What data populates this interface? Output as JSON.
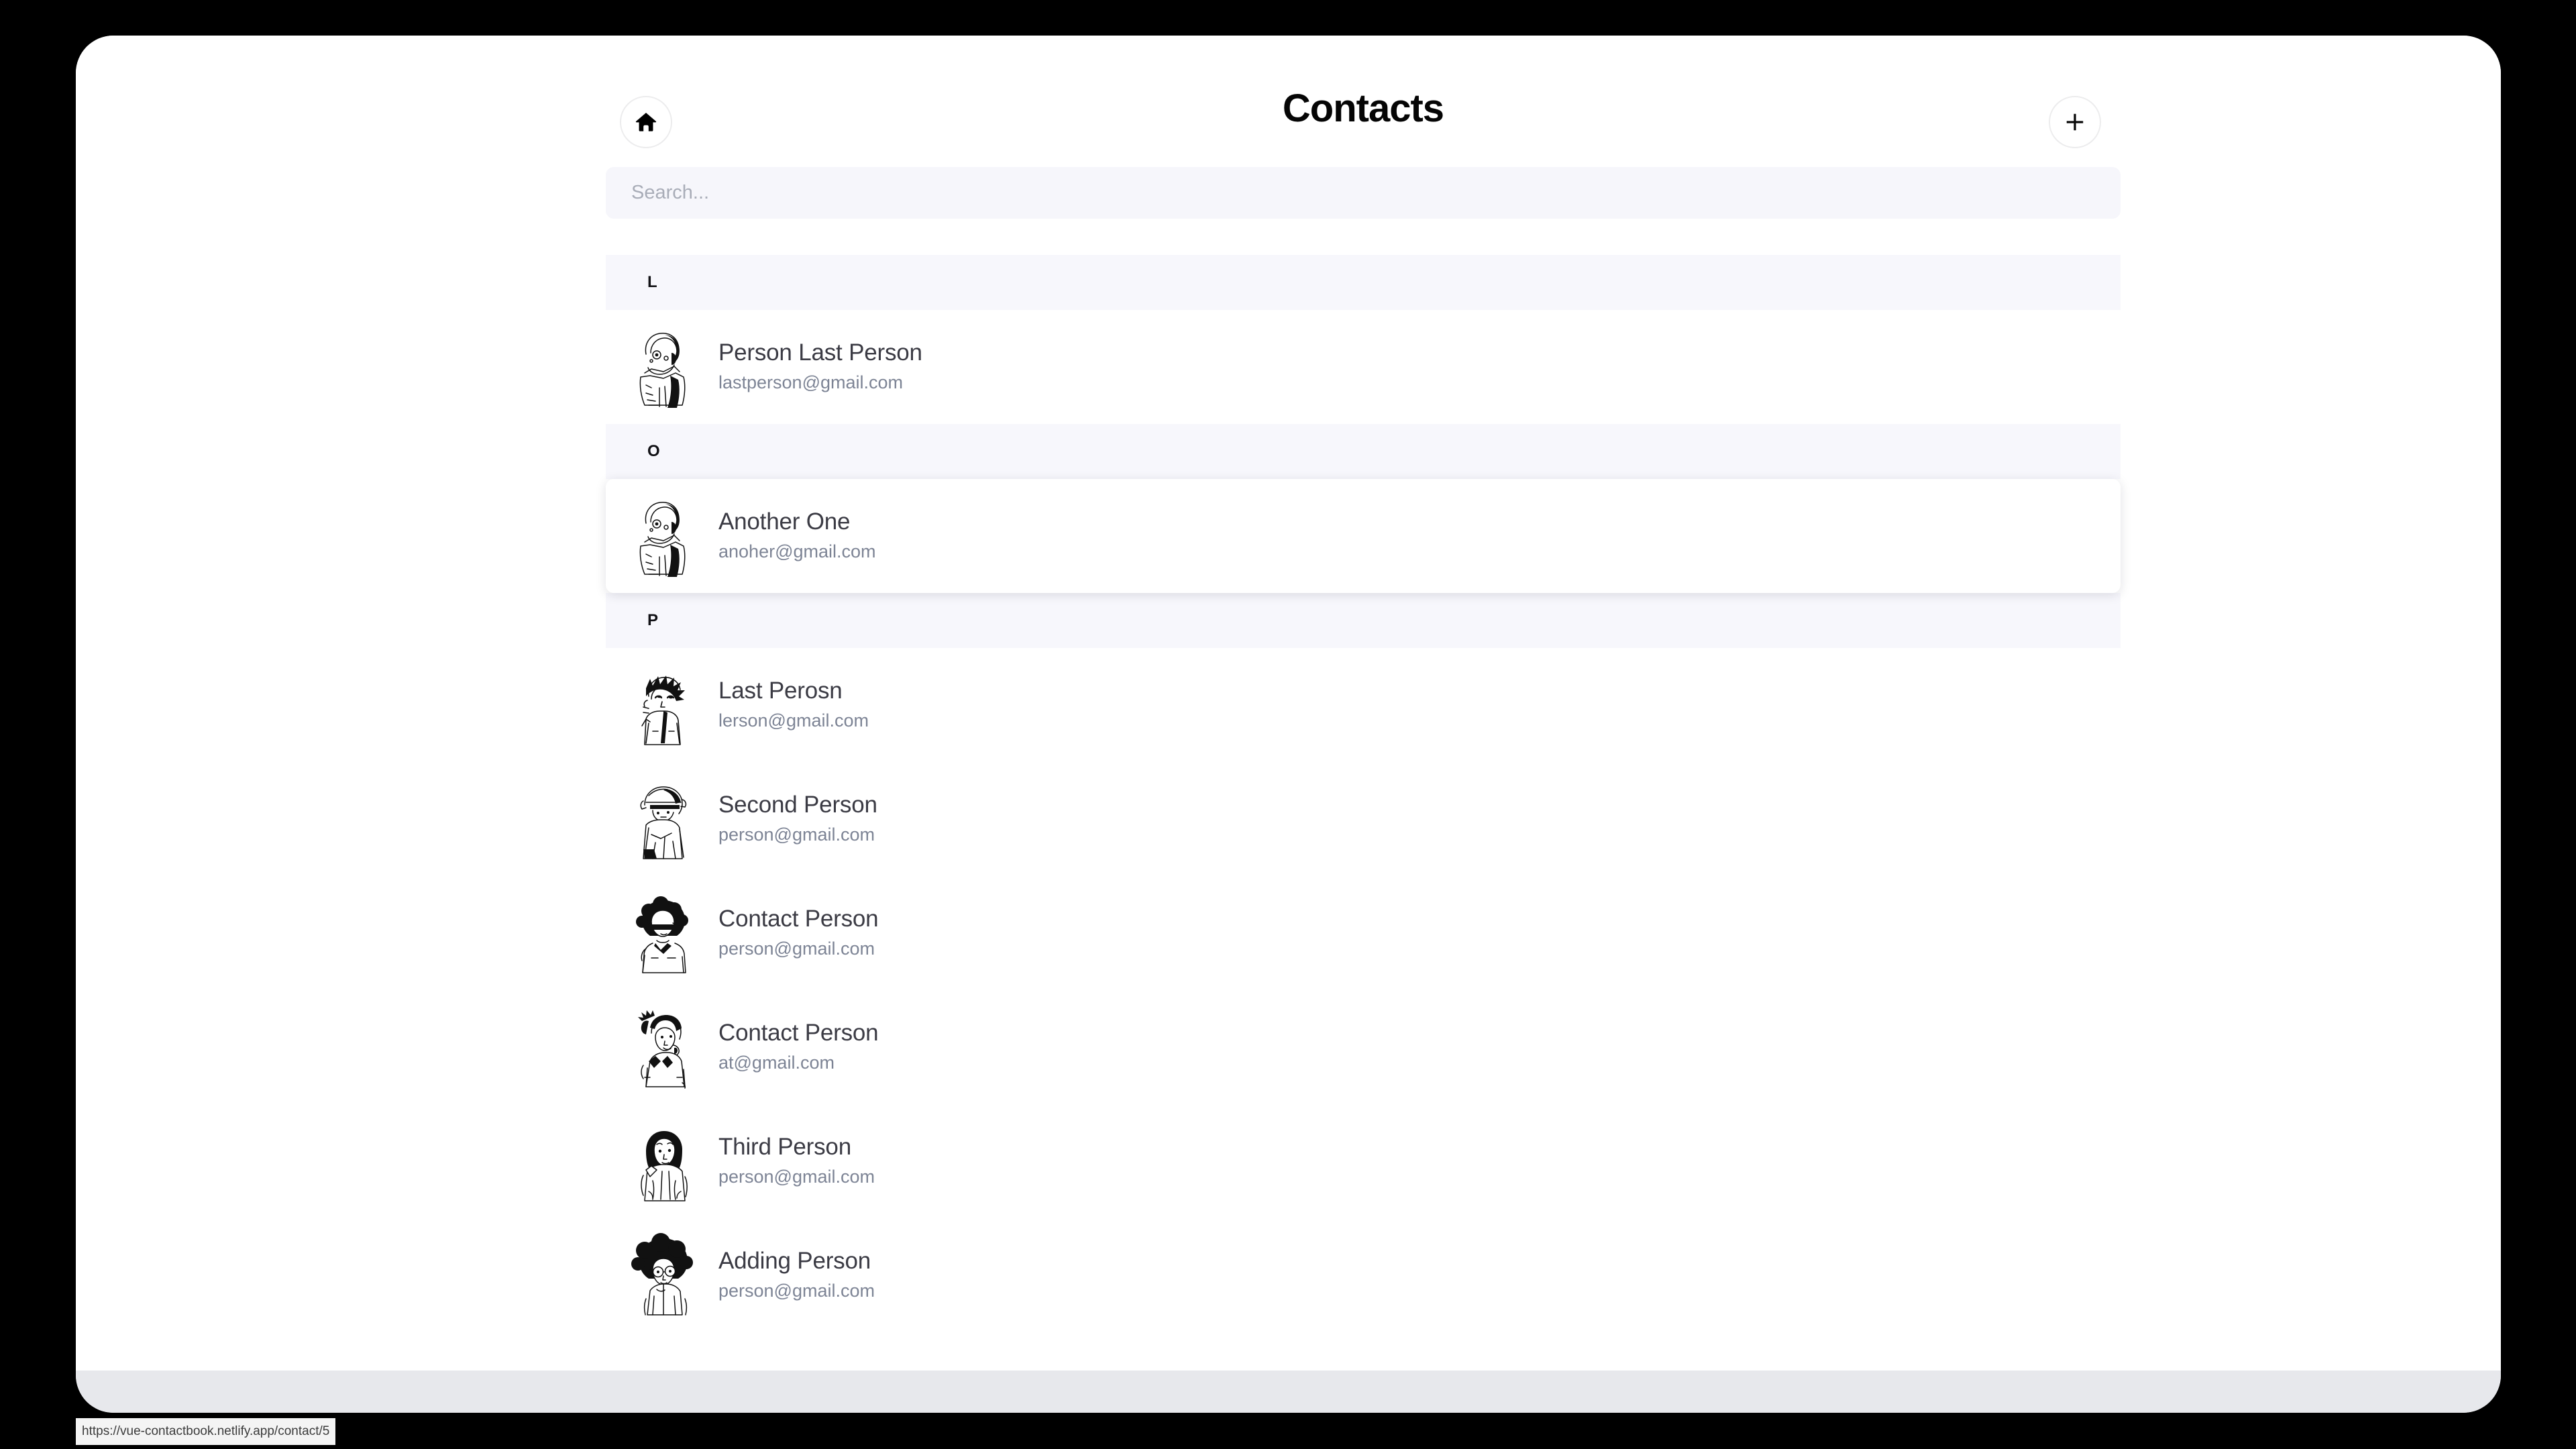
{
  "header": {
    "title": "Contacts",
    "home_button_icon": "home-icon",
    "add_button_icon": "plus-icon"
  },
  "search": {
    "placeholder": "Search...",
    "value": ""
  },
  "sections": [
    {
      "letter": "L",
      "contacts": [
        {
          "name": "Person Last Person",
          "email": "lastperson@gmail.com",
          "avatar": "avatar-astronaut",
          "hovered": false
        }
      ]
    },
    {
      "letter": "O",
      "contacts": [
        {
          "name": "Another One",
          "email": "anoher@gmail.com",
          "avatar": "avatar-astronaut",
          "hovered": true
        }
      ]
    },
    {
      "letter": "P",
      "contacts": [
        {
          "name": "Last Perosn",
          "email": "lerson@gmail.com",
          "avatar": "avatar-spiky-hair",
          "hovered": false
        },
        {
          "name": "Second Person",
          "email": "person@gmail.com",
          "avatar": "avatar-helmet",
          "hovered": false
        },
        {
          "name": "Contact Person",
          "email": "person@gmail.com",
          "avatar": "avatar-afro-sunglasses",
          "hovered": false
        },
        {
          "name": "Contact Person",
          "email": "at@gmail.com",
          "avatar": "avatar-ponytail",
          "hovered": false
        },
        {
          "name": "Third Person",
          "email": "person@gmail.com",
          "avatar": "avatar-bob-hair",
          "hovered": false
        },
        {
          "name": "Adding Person",
          "email": "person@gmail.com",
          "avatar": "avatar-afro-glasses",
          "hovered": false
        }
      ]
    }
  ],
  "status_bar": {
    "url": "https://vue-contactbook.netlify.app/contact/5"
  },
  "colors": {
    "page_background": "#ffffff",
    "outer_background": "#000000",
    "section_header_background": "#f7f7fc",
    "search_background": "#f6f6fb",
    "name_text": "#3b3b44",
    "email_text": "#7d8495",
    "title_text": "#050505",
    "scrollbar_track": "#e7e8ec"
  }
}
